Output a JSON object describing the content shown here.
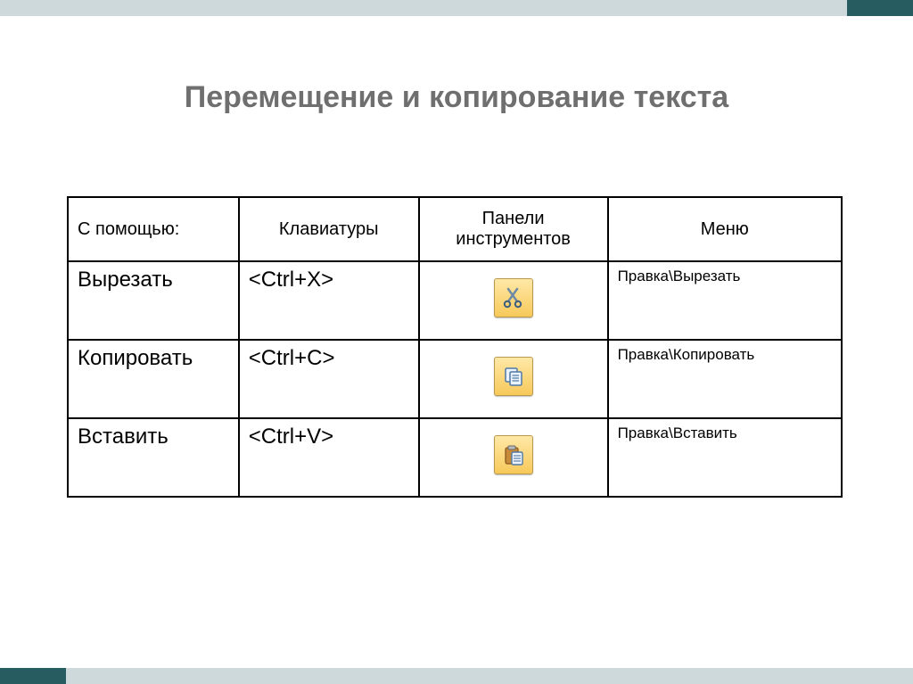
{
  "title": "Перемещение и копирование текста",
  "table": {
    "headers": {
      "with": "С помощью:",
      "keyboard": "Клавиатуры",
      "toolbar": "Панели инструментов",
      "menu": "Меню"
    },
    "rows": [
      {
        "operation": "Вырезать",
        "shortcut": "<Ctrl+X>",
        "icon": "cut-icon",
        "menu_path": "Правка\\Вырезать"
      },
      {
        "operation": "Копировать",
        "shortcut": "<Ctrl+C>",
        "icon": "copy-icon",
        "menu_path": "Правка\\Копировать"
      },
      {
        "operation": "Вставить",
        "shortcut": "<Ctrl+V>",
        "icon": "paste-icon",
        "menu_path": "Правка\\Вставить"
      }
    ]
  }
}
